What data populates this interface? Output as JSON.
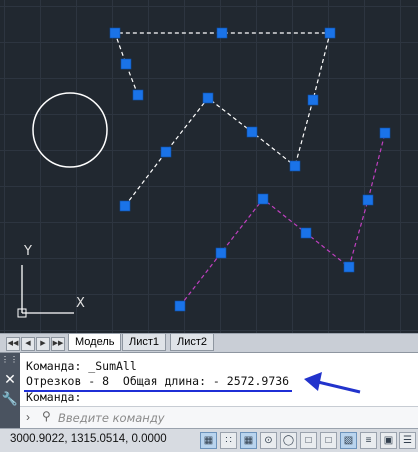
{
  "viewport": {
    "axis_y_label": "Y",
    "axis_x_label": "X"
  },
  "layout_tabs": [
    "Модель",
    "Лист1",
    "Лист2"
  ],
  "command_history": [
    "Команда: _SumAll",
    "Отрезков - 8  Общая длина: - 2572.9736",
    "Команда:"
  ],
  "command_input": {
    "placeholder": "Введите команду"
  },
  "status_bar": {
    "coordinates": "3000.9022, 1315.0514, 0.0000",
    "toggle_icons": [
      "grid-icon",
      "snap-icon",
      "ortho-icon",
      "polar-icon",
      "osnap-icon",
      "otrack-icon",
      "ducs-icon",
      "dyn-icon",
      "lineweight-icon",
      "transparency-icon",
      "quick-properties-icon"
    ]
  },
  "colors": {
    "grip": "#1a73e8",
    "white_lines": "#ffffff",
    "magenta_lines": "#c040c0",
    "annotation_arrow": "#2233cc",
    "underline": "#1f2fd6"
  }
}
